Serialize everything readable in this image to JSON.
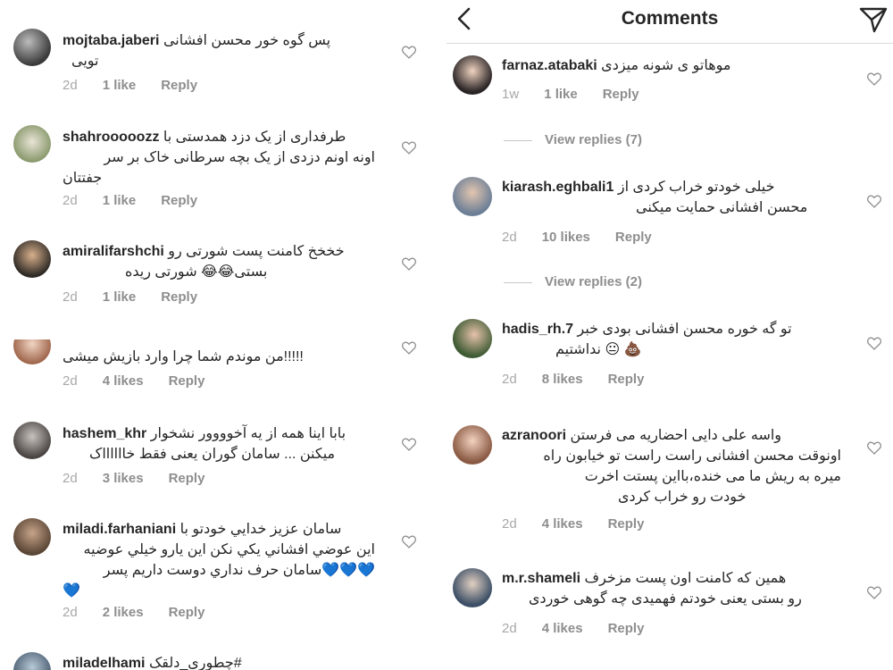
{
  "header": {
    "title": "Comments",
    "back_icon": "chevron-left-icon",
    "send_icon": "send-icon"
  },
  "left_comments": [
    {
      "user": "mojtaba.jaberi",
      "lines": [
        "پس گوه خور محسن افشانی",
        "تویی"
      ],
      "time": "2d",
      "likes": "1 like",
      "reply": "Reply"
    },
    {
      "user": "shahrooooozz",
      "lines": [
        "طرفداری از یک دزد همدستی با",
        "اونه اونم دزدی از یک بچه سرطانی خاک بر سر",
        "جفتتان"
      ],
      "time": "2d",
      "likes": "1 like",
      "reply": "Reply"
    },
    {
      "user": "amiralifarshchi",
      "lines": [
        "خخخخ کامنت پست شورتی رو",
        "بستی😂😂 شورتی ریده"
      ],
      "time": "2d",
      "likes": "1 like",
      "reply": "Reply"
    },
    {
      "user": "",
      "lines": [
        "!!!!!من موندم شما چرا وارد بازیش میشی"
      ],
      "time": "2d",
      "likes": "4 likes",
      "reply": "Reply"
    },
    {
      "user": "hashem_khr",
      "lines": [
        "بابا اینا همه از یه آخوووور نشخوار",
        "میکنن ... سامان گوران یعنی فقط خااااااک"
      ],
      "time": "2d",
      "likes": "3 likes",
      "reply": "Reply"
    },
    {
      "user": "miladi.farhaniani",
      "lines": [
        "سامان عزيز خدايي خودتو با",
        "اين عوضي افشاني يكي نكن اين يارو خيلي عوضيه",
        "💙💙💙سامان حرف نداري دوست داريم پسر",
        "💙"
      ],
      "time": "2d",
      "likes": "2 likes",
      "reply": "Reply"
    },
    {
      "user": "miladelhami",
      "lines": [
        "#چطوری_دلقک"
      ],
      "time": "",
      "likes": "",
      "reply": ""
    }
  ],
  "right_comments": [
    {
      "user": "farnaz.atabaki",
      "lines": [
        "موهاتو ی شونه میزدی"
      ],
      "time": "1w",
      "likes": "1 like",
      "reply": "Reply"
    },
    {
      "user": "kiarash.eghbali1",
      "lines": [
        "خیلی خودتو خراب کردی از",
        "محسن افشانی حمایت میکنی"
      ],
      "time": "2d",
      "likes": "10 likes",
      "reply": "Reply"
    },
    {
      "user": "hadis_rh.7",
      "lines": [
        "تو گه خوره محسن افشانی بودی خبر",
        "💩 😐 نداشتیم"
      ],
      "time": "2d",
      "likes": "8 likes",
      "reply": "Reply"
    },
    {
      "user": "azranoori",
      "lines": [
        "واسه علی دایی احضاریه می فرستن",
        "اونوقت محسن افشانی راست راست تو خیابون راه",
        "میره به ریش ما می خنده،بااین پستت اخرت",
        "خودت رو خراب کردی"
      ],
      "time": "2d",
      "likes": "4 likes",
      "reply": "Reply"
    },
    {
      "user": "m.r.shameli",
      "lines": [
        "همین که کامنت اون پست مزخرف",
        "رو بستی یعنی خودتم فهمیدی چه گوهی خوردی"
      ],
      "time": "2d",
      "likes": "4 likes",
      "reply": "Reply"
    }
  ],
  "view_replies": [
    "View replies (7)",
    "View replies (2)"
  ],
  "colors": {
    "text": "#262626",
    "muted": "#8e8e8e",
    "divider": "#dbdbdb",
    "heart": "#8e8e8e"
  }
}
